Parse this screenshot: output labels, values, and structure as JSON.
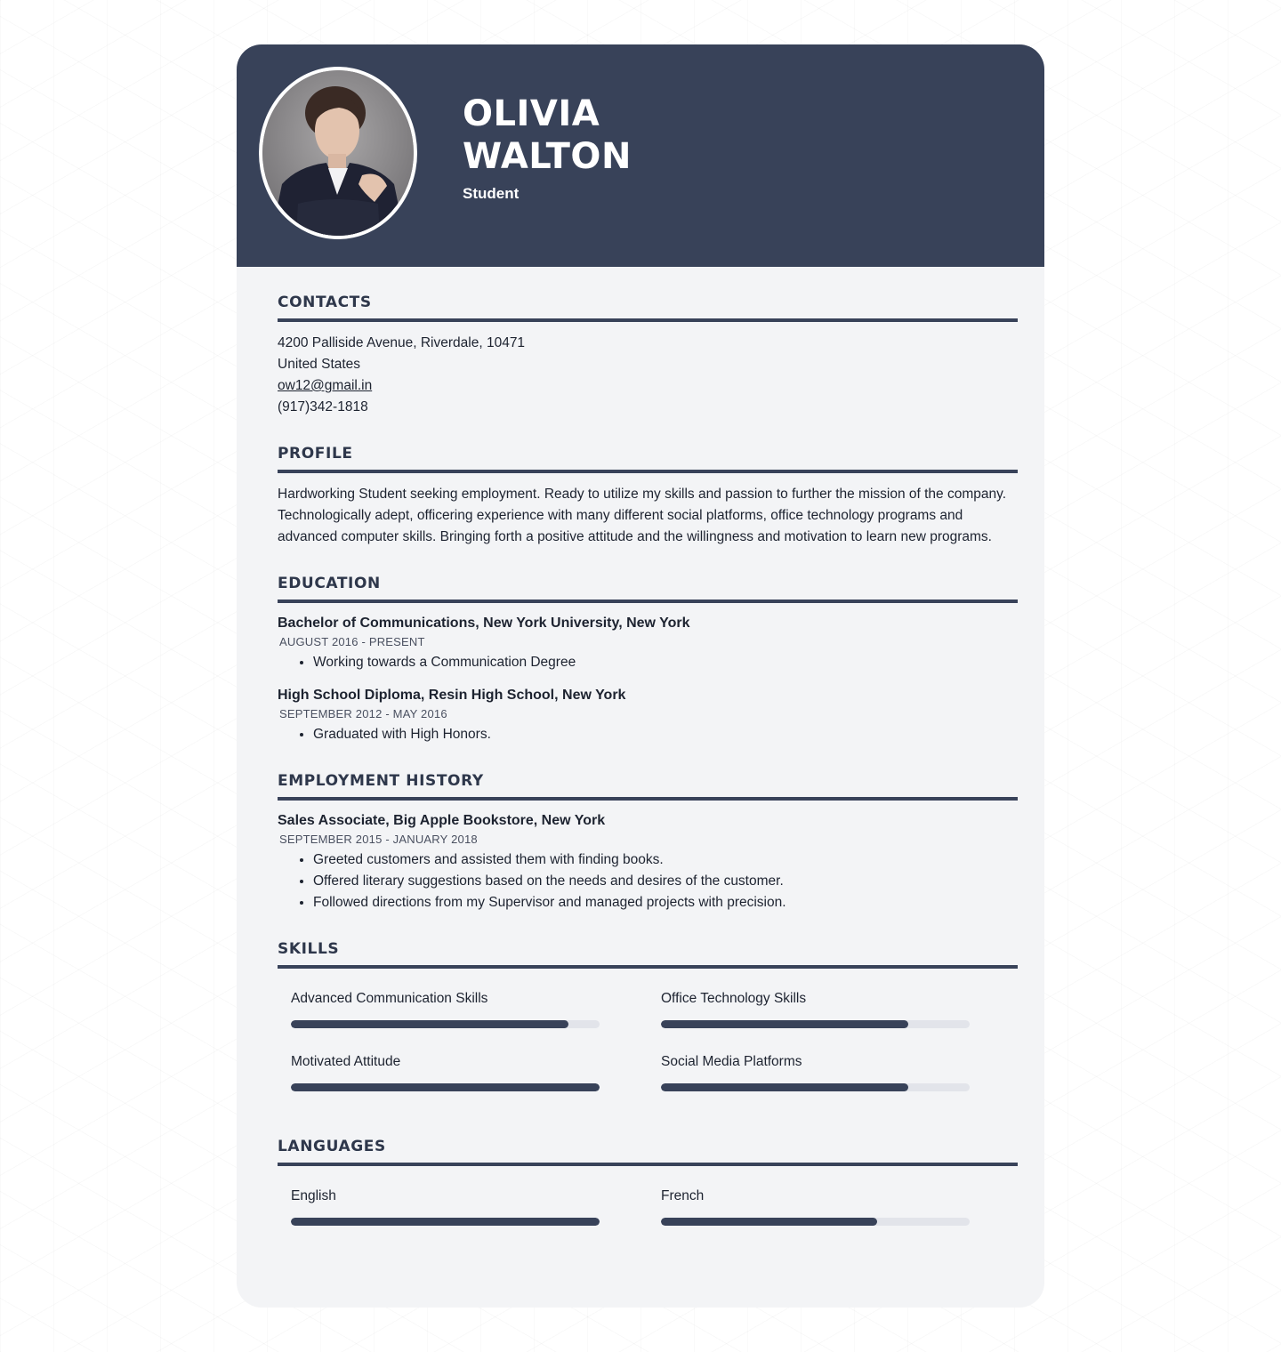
{
  "header": {
    "first_name": "OLIVIA",
    "last_name": "WALTON",
    "role": "Student"
  },
  "contacts": {
    "title": "CONTACTS",
    "address": "4200 Palliside Avenue, Riverdale, 10471",
    "country": "United States",
    "email": "ow12@gmail.in",
    "phone": "(917)342-1818"
  },
  "profile": {
    "title": "PROFILE",
    "text": "Hardworking Student seeking employment. Ready to utilize my skills and passion to further the mission of the company. Technologically adept, officering experience with many different social platforms, office technology programs and advanced computer skills. Bringing forth a positive attitude and the willingness and motivation to learn new programs."
  },
  "education": {
    "title": "EDUCATION",
    "entries": [
      {
        "title": "Bachelor of Communications, New York University, New York",
        "date": "AUGUST 2016 - PRESENT",
        "bullets": [
          "Working towards a Communication Degree"
        ]
      },
      {
        "title": "High School Diploma, Resin High School, New York",
        "date": "SEPTEMBER 2012 - MAY 2016",
        "bullets": [
          "Graduated with High Honors."
        ]
      }
    ]
  },
  "employment": {
    "title": "EMPLOYMENT HISTORY",
    "entries": [
      {
        "title": "Sales Associate, Big Apple Bookstore, New York",
        "date": "SEPTEMBER 2015 - JANUARY 2018",
        "bullets": [
          "Greeted customers and assisted them with finding books.",
          "Offered literary suggestions based on the needs and desires of the customer.",
          "Followed directions from my Supervisor and managed projects with precision."
        ]
      }
    ]
  },
  "skills": {
    "title": "SKILLS",
    "items": [
      {
        "name": "Advanced Communication Skills",
        "level": 0.9
      },
      {
        "name": "Office Technology Skills",
        "level": 0.8
      },
      {
        "name": "Motivated Attitude",
        "level": 1.0
      },
      {
        "name": "Social Media Platforms",
        "level": 0.8
      }
    ]
  },
  "languages": {
    "title": "LANGUAGES",
    "items": [
      {
        "name": "English",
        "level": 1.0
      },
      {
        "name": "French",
        "level": 0.7
      }
    ]
  },
  "colors": {
    "header_bg": "#384259",
    "bar_fill": "#384259",
    "bar_track": "#e2e4ea",
    "card_bg": "#f3f4f6"
  }
}
